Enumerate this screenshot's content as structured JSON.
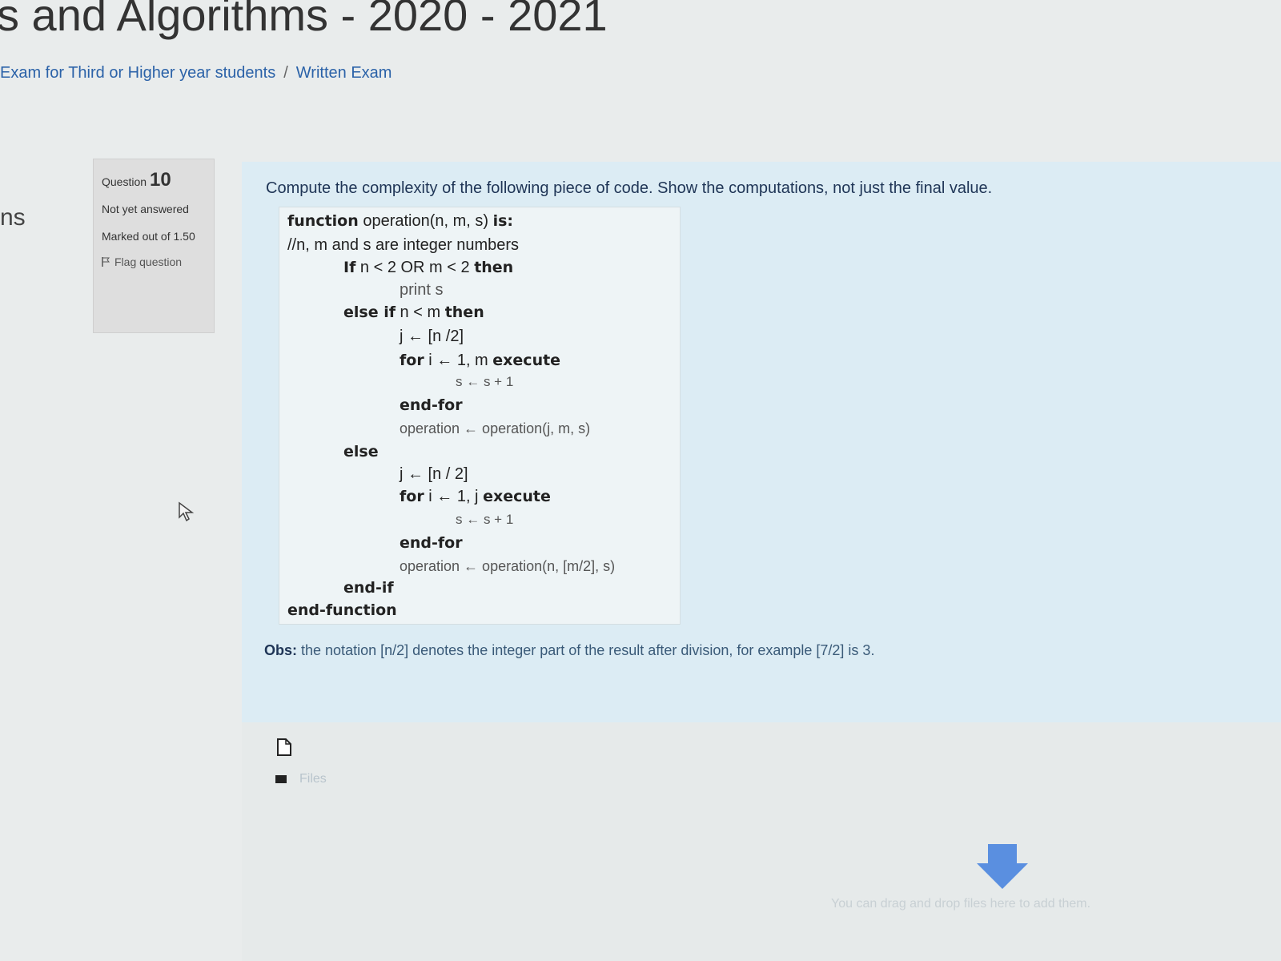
{
  "header": {
    "title": "s and Algorithms - 2020 - 2021",
    "breadcrumb": [
      "Exam for Third or Higher year students",
      "Written Exam"
    ],
    "breadcrumb_sep": "/",
    "left_fragment": "ns"
  },
  "question_info": {
    "label": "Question",
    "number": "10",
    "state": "Not yet answered",
    "grade": "Marked out of 1.50",
    "flag_label": "Flag question"
  },
  "question": {
    "text": "Compute the complexity of the following piece of code. Show the computations, not just the final value.",
    "code": {
      "l1_kw": "function",
      "l1_rest": " operation(n, m, s) ",
      "l1_kw2": "is:",
      "l2": "//n, m and s are integer numbers",
      "l3_kw": "If",
      "l3_rest": " n < 2 OR m < 2 ",
      "l3_kw2": "then",
      "l4": "print s",
      "l5_kw": "else if",
      "l5_rest": " n < m ",
      "l5_kw2": "then",
      "l6": "j ← [n /2]",
      "l7_kw": "for",
      "l7_rest": " i ← 1, m ",
      "l7_kw2": "execute",
      "l8": "s ← s + 1",
      "l9": "end-for",
      "l10": "operation ← operation(j, m, s)",
      "l11": "else",
      "l12": "j ← [n / 2]",
      "l13_kw": "for",
      "l13_rest": " i ← 1, j ",
      "l13_kw2": "execute",
      "l14": "s ← s + 1",
      "l15": "end-for",
      "l16": "operation ← operation(n, [m/2], s)",
      "l17": "end-if",
      "l18": "end-function"
    },
    "obs_label": "Obs:",
    "obs_text": " the notation [n/2] denotes the integer part of the result after division, for example [7/2] is 3."
  },
  "file_picker": {
    "files_label": "Files",
    "drop_text": "You can drag and drop files here to add them.",
    "icons": [
      "file-icon",
      "folder-icon",
      "download-arrow-icon",
      "cursor-icon",
      "flag-icon"
    ]
  },
  "colors": {
    "content_bg": "#dcecf4",
    "link": "#2b62a8",
    "drop_arrow": "#5a8fe0"
  }
}
